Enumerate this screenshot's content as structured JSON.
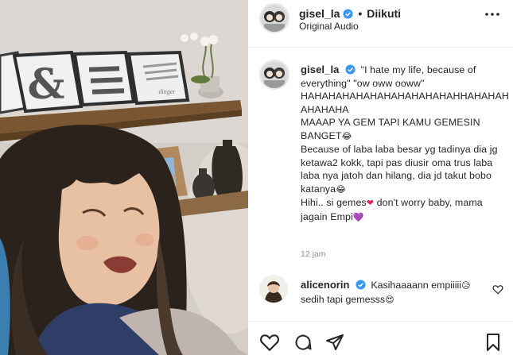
{
  "post": {
    "username": "gisel_la",
    "separator": "•",
    "follow_status": "Diikuti",
    "audio": "Original Audio"
  },
  "caption": {
    "username": "gisel_la",
    "line1": "\"I hate my life, because of everything\" \"ow oww ooww\"",
    "line2": "HAHAHAHAHAHAHAHAHAHAHAHHAHAHAHAHAHAHA",
    "line3": "MAAAP YA GEM TAPI KAMU GEMESIN BANGET",
    "line3_emoji": "😂",
    "line4": "Because of laba laba besar yg tadinya dia jg ketawa2 kokk, tapi pas diusir oma trus laba laba nya jatoh dan hilang, dia jd takut bobo katanya",
    "line4_emoji": "😂",
    "line5": "Hihi.. si gemes",
    "line5_emoji": "❤",
    "line5_rest": " don't worry baby, mama jagain Empi",
    "line5_emoji2": "💜",
    "time": "12 jam"
  },
  "comment": {
    "username": "alicenorin",
    "text": "Kasihaaaann empiiiii",
    "emoji1": "😥",
    "text2": "sedih tapi gemesss",
    "emoji2": "😍"
  },
  "icons": {
    "verified": "verified-badge-icon",
    "more": "more-options-icon",
    "like": "heart-icon",
    "comment": "comment-icon",
    "share": "share-icon",
    "save": "bookmark-icon",
    "verified_color": "#3897f0"
  },
  "media": {
    "frame_text": "dinger"
  }
}
